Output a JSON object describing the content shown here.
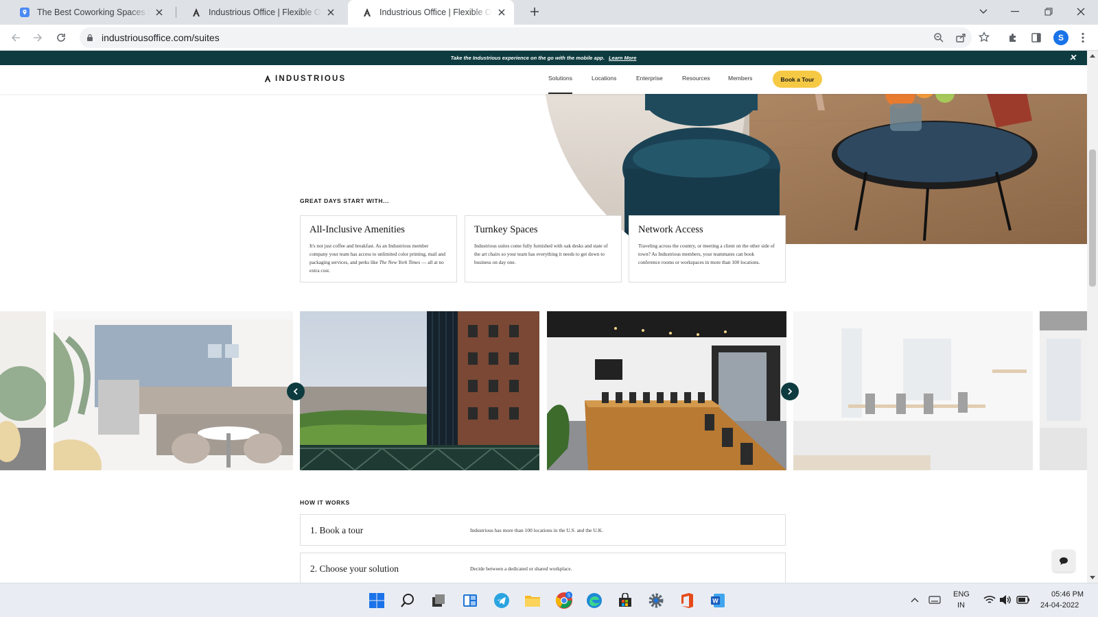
{
  "browser": {
    "tabs": [
      {
        "title": "The Best Coworking Spaces In Au",
        "icon": "map-pin-icon"
      },
      {
        "title": "Industrious Office | Flexible Offic",
        "icon": "industrious-icon"
      },
      {
        "title": "Industrious Office | Flexible Offic",
        "icon": "industrious-icon"
      }
    ],
    "active_tab": 2,
    "url": "industriousoffice.com/suites",
    "profile_initial": "S"
  },
  "site": {
    "banner": {
      "text": "Take the Industrious experience on the go with the mobile app.",
      "link": "Learn More"
    },
    "logo": "INDUSTRIOUS",
    "nav": [
      "Solutions",
      "Locations",
      "Enterprise",
      "Resources",
      "Members"
    ],
    "nav_active": "Solutions",
    "cta": "Book a Tour",
    "amenities_kicker": "GREAT DAYS START WITH...",
    "cards": [
      {
        "title": "All-Inclusive Amenities",
        "text_a": "It's not just coffee and breakfast. As an Industrious member company your team has access to unlimited color printing, mail and packaging services, and perks like ",
        "text_em": "The New York Times",
        "text_b": " — all at no extra cost."
      },
      {
        "title": "Turnkey Spaces",
        "text_a": "Industrious suites come fully furnished with oak desks and state of the art chairs so your team has everything it needs to get down to business on day one.",
        "text_em": "",
        "text_b": ""
      },
      {
        "title": "Network Access",
        "text_a": "Traveling across the country, or meeting a client on the other side of town? As Industrious members, your teammates can book conference rooms or workspaces in more than 100 locations.",
        "text_em": "",
        "text_b": ""
      }
    ],
    "how_kicker": "HOW IT WORKS",
    "steps": [
      {
        "label": "1.  Book a tour",
        "desc": "Industrious has more than 100 locations in the U.S. and the U.K."
      },
      {
        "label": "2.  Choose your solution",
        "desc": "Decide between a dedicated or shared workplace."
      }
    ]
  },
  "taskbar": {
    "lang_top": "ENG",
    "lang_bottom": "IN",
    "time": "05:46 PM",
    "date": "24-04-2022"
  },
  "colors": {
    "brand_dark": "#0d3b3f",
    "cta_yellow": "#f6c945",
    "chrome_blue": "#1a73e8"
  }
}
